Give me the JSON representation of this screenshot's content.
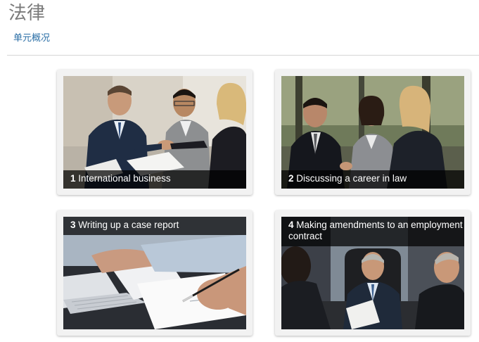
{
  "header": {
    "title": "法律",
    "overview_link": "单元概况"
  },
  "cards": [
    {
      "number": "1",
      "title": "International business"
    },
    {
      "number": "2",
      "title": "Discussing a career in law"
    },
    {
      "number": "3",
      "title": "Writing up a case report"
    },
    {
      "number": "4",
      "title": "Making amendments to an employment contract"
    }
  ]
}
